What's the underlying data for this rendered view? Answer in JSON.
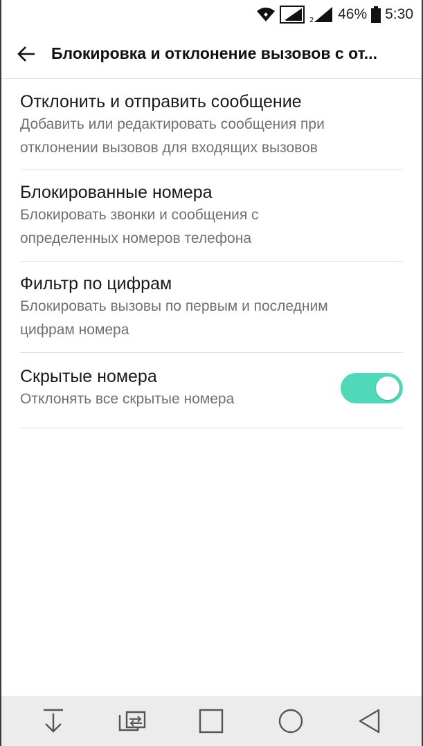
{
  "status_bar": {
    "battery_percent": "46%",
    "time": "5:30",
    "icons": [
      "wifi-icon",
      "sim1-signal-icon",
      "sim2-signal-icon",
      "battery-icon"
    ]
  },
  "app_bar": {
    "title": "Блокировка и отклонение вызовов с от..."
  },
  "settings": [
    {
      "title": "Отклонить и отправить сообщение",
      "summary_line1": "Добавить или редактировать сообщения при",
      "summary_line2": "отклонении вызовов для входящих вызовов"
    },
    {
      "title": "Блокированные номера",
      "summary_line1": "Блокировать звонки и сообщения с",
      "summary_line2": "определенных номеров телефона"
    },
    {
      "title": "Фильтр по цифрам",
      "summary_line1": "Блокировать вызовы по первым и последним",
      "summary_line2": "цифрам номера"
    },
    {
      "title": "Скрытые номера",
      "summary_line1": "Отклонять все скрытые номера",
      "toggle_on": true
    }
  ],
  "colors": {
    "accent": "#4fd9b8"
  },
  "nav_bar": {
    "icons": [
      "notification-pull-down-icon",
      "dual-window-icon",
      "recents-icon",
      "home-icon",
      "back-icon"
    ]
  }
}
